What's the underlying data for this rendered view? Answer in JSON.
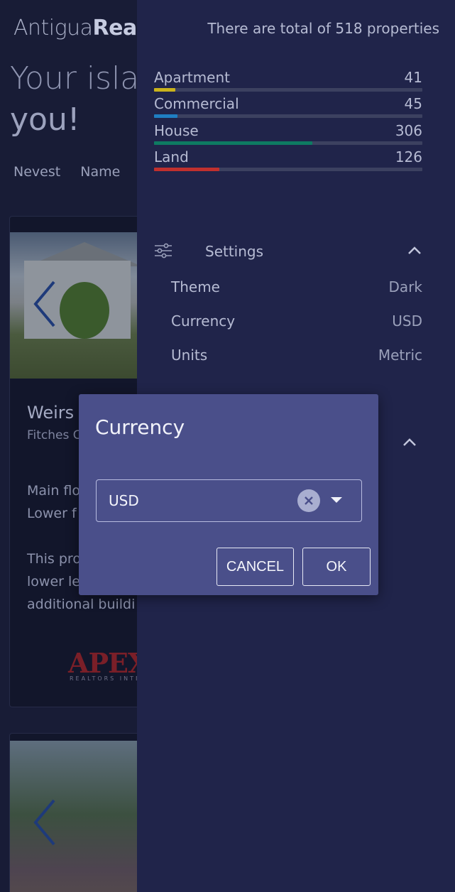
{
  "background": {
    "logo": {
      "light": "Antigua",
      "bold": "Real"
    },
    "hero": {
      "line1": "Your isla",
      "line2": "you!"
    },
    "sort_options": [
      "Nevest",
      "Name"
    ],
    "listing1": {
      "title": "Weirs",
      "location": "Fitches C",
      "body_lines": [
        "Main flo",
        "Lower f",
        "",
        "This pro",
        "lower le",
        "additional buildi"
      ],
      "agency_logo": "APEX",
      "agency_sub": "REALTORS INTERNATIONAL"
    }
  },
  "drawer": {
    "total_text": "There are total of 518 properties",
    "categories": [
      {
        "name": "Apartment",
        "count": "41",
        "fraction": 0.079,
        "color": "#c9b21c"
      },
      {
        "name": "Commercial",
        "count": "45",
        "fraction": 0.087,
        "color": "#1f7ec2"
      },
      {
        "name": "House",
        "count": "306",
        "fraction": 0.591,
        "color": "#0e7a62"
      },
      {
        "name": "Land",
        "count": "126",
        "fraction": 0.243,
        "color": "#c0302e"
      }
    ],
    "settings": {
      "label": "Settings",
      "rows": [
        {
          "label": "Theme",
          "value": "Dark"
        },
        {
          "label": "Currency",
          "value": "USD"
        },
        {
          "label": "Units",
          "value": "Metric"
        }
      ]
    }
  },
  "dialog": {
    "title": "Currency",
    "selected": "USD",
    "cancel_label": "CANCEL",
    "ok_label": "OK"
  },
  "colors": {
    "drawer_bg": "#20244a",
    "dialog_bg": "#4a4f8a"
  }
}
